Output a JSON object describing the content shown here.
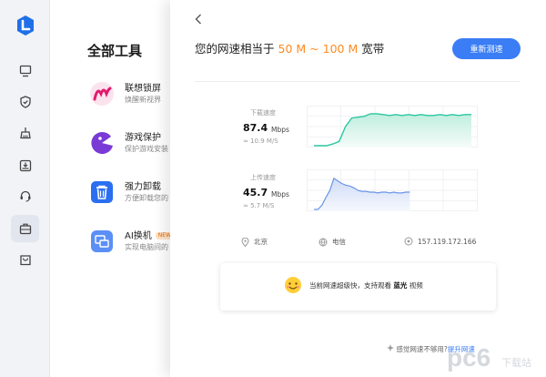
{
  "sidebar": {
    "items": [
      {
        "icon": "computer-icon"
      },
      {
        "icon": "shield-check-icon"
      },
      {
        "icon": "broom-icon"
      },
      {
        "icon": "download-tray-icon"
      },
      {
        "icon": "headset-icon"
      },
      {
        "icon": "toolbox-icon",
        "active": true
      },
      {
        "icon": "bag-icon"
      }
    ]
  },
  "tools": {
    "title": "全部工具",
    "items": [
      {
        "name": "联想锁屏",
        "desc": "焕醒新视界",
        "icon": "lenovo-lockscreen-icon"
      },
      {
        "name": "游戏保护",
        "desc": "保护游戏安装",
        "icon": "game-protect-icon"
      },
      {
        "name": "强力卸载",
        "desc": "方便卸载您的",
        "icon": "trash-icon"
      },
      {
        "name": "AI换机",
        "desc": "实现电脑间的",
        "badge": "NEW",
        "icon": "ai-switch-icon"
      }
    ]
  },
  "speedtest": {
    "headline_prefix": "您的网速相当于",
    "range_low": "50 M",
    "range_sep": "~",
    "range_high": "100 M",
    "headline_suffix": "宽带",
    "retest_label": "重新测速",
    "download": {
      "label": "下载速度",
      "value": "87.4",
      "unit": "Mbps",
      "equiv": "≈ 10.9 M/S"
    },
    "upload": {
      "label": "上传速度",
      "value": "45.7",
      "unit": "Mbps",
      "equiv": "≈ 5.7 M/S"
    },
    "location": "北京",
    "isp": "电信",
    "ip": "157.119.172.166",
    "tip_prefix": "当前网速超级快，支持观看",
    "tip_quality": "蓝光",
    "tip_suffix": "视频",
    "footer_text": "感觉网速不够用?",
    "footer_link": "提升网速"
  },
  "chart_data": [
    {
      "type": "area",
      "name": "download",
      "color": "#2ec6a0",
      "values": [
        0,
        0,
        0,
        2,
        5,
        22,
        32,
        33,
        34,
        37,
        37,
        36,
        35,
        36,
        35,
        36,
        35,
        36,
        35,
        35,
        36,
        35,
        36,
        35,
        36,
        36
      ]
    },
    {
      "type": "area",
      "name": "upload",
      "color": "#6a95e8",
      "values": [
        0,
        0,
        5,
        14,
        22,
        36,
        33,
        30,
        28,
        27,
        25,
        22,
        21,
        21,
        20,
        20,
        19,
        20,
        20,
        19,
        20,
        19,
        19,
        20,
        20
      ]
    }
  ],
  "colors": {
    "accent": "#3a7df5",
    "highlight": "#ff8a1f",
    "download": "#2ec6a0",
    "upload": "#6a95e8"
  },
  "watermark": {
    "text": "pc6",
    "sub": "下载站"
  }
}
